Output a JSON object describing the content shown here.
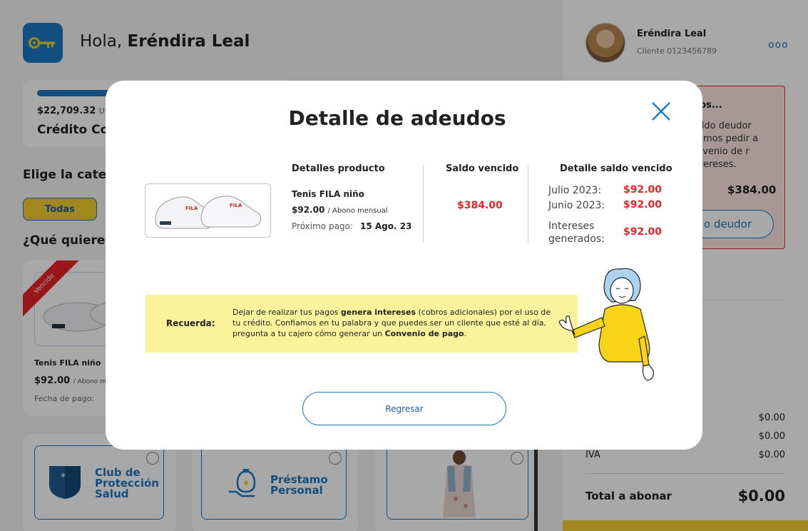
{
  "header": {
    "greeting": "Hola,",
    "user_name": "Eréndira Leal"
  },
  "credit": {
    "amount": "$22,709.32",
    "util_label": "Utili",
    "name": "Crédito Co"
  },
  "categories": {
    "title": "Elige la catego",
    "chip_all": "Todas"
  },
  "want": {
    "title": "¿Qué quieres"
  },
  "product_card": {
    "ribbon": "Vencido",
    "name": "Tenis FILA niño",
    "price": "$92.00",
    "price_suffix": "/ Abono m",
    "date_label": "Fecha de pago:"
  },
  "services": {
    "club_label": "Club de Protección Salud",
    "loan_label": "Préstamo Personal"
  },
  "right_panel": {
    "user_name": "Eréndira Leal",
    "client_id": "Cliente 0123456789",
    "more": "ooo",
    "debt_title": "nos...",
    "debt_text": "saldo deudor erimos pedir a onvenio de r intereses.",
    "debt_amount": "$384.00",
    "debt_button": "o deudor",
    "rows": [
      {
        "label": "",
        "value": "$0.00"
      },
      {
        "label": "",
        "value": "$0.00"
      },
      {
        "label": "IVA",
        "value": "$0.00"
      }
    ],
    "total_label": "Total a abonar",
    "total_value": "$0.00"
  },
  "modal": {
    "title": "Detalle de adeudos",
    "col_product": "Detalles producto",
    "col_saldo": "Saldo vencido",
    "col_detail": "Detalle saldo vencido",
    "product_name": "Tenis FILA niño",
    "product_price": "$92.00",
    "product_price_suffix": "/ Abono mensual",
    "next_payment_label": "Próximo pago:",
    "next_payment_date": "15 Ago. 23",
    "saldo_value": "$384.00",
    "details": [
      {
        "label": "Julio 2023:",
        "value": "$92.00"
      },
      {
        "label": "Junio 2023:",
        "value": "$92.00"
      },
      {
        "label": "Intereses generados:",
        "value": "$92.00"
      }
    ],
    "reminder_label": "Recuerda:",
    "reminder_p1": "Dejar de realizar tus pagos ",
    "reminder_b1": "genera intereses",
    "reminder_p2": " (cobros adicionales) por el uso de tu crédito. Confiamos en tu palabra y que puedes ser un cliente que esté al día, pregunta a tu cajero cómo generar un ",
    "reminder_b2": "Convenio de pago",
    "reminder_p3": ".",
    "back_button": "Regresar"
  },
  "colors": {
    "brand_blue": "#1a78c2",
    "alert_red": "#e5232a",
    "brand_yellow": "#f5cf2e",
    "reminder_bg": "#fbf39c"
  },
  "icons": {
    "logo": "key-icon",
    "close": "close-icon",
    "more": "more-dots-icon"
  }
}
